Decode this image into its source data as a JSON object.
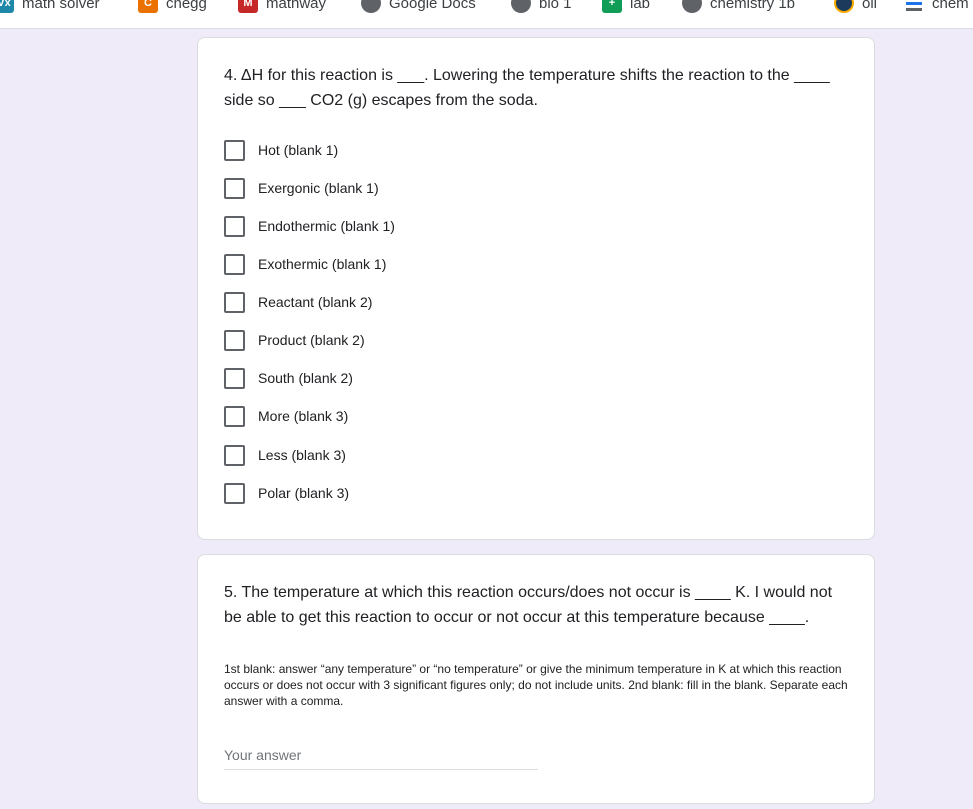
{
  "bookmarks": [
    {
      "label": "math solver",
      "icon": "vx-icon",
      "glyph": "Vx",
      "color": "#1e88a8"
    },
    {
      "label": "chegg",
      "icon": "chegg-icon",
      "glyph": "C",
      "color": "#eb7100"
    },
    {
      "label": "mathway",
      "icon": "mathway-icon",
      "glyph": "M",
      "color": "#c62828"
    },
    {
      "label": "Google Docs",
      "icon": "globe-icon",
      "glyph": "",
      "color": "#5f6368"
    },
    {
      "label": "bio 1",
      "icon": "globe-icon",
      "glyph": "",
      "color": "#5f6368"
    },
    {
      "label": "lab",
      "icon": "google-sheets-icon",
      "glyph": "+",
      "color": "#0f9d58"
    },
    {
      "label": "chemistry 1b",
      "icon": "globe-icon",
      "glyph": "",
      "color": "#5f6368"
    },
    {
      "label": "oli",
      "icon": "oli-icon",
      "glyph": "",
      "color": "#1b3a5c"
    },
    {
      "label": "chem",
      "icon": "stack-icon",
      "glyph": "",
      "color": "#f9ab00"
    }
  ],
  "question4": {
    "title": "4. ΔH for this reaction is ___. Lowering the temperature shifts the reaction to the ____ side so ___ CO2 (g) escapes from the soda.",
    "options": [
      "Hot (blank 1)",
      "Exergonic (blank 1)",
      "Endothermic (blank 1)",
      "Exothermic (blank 1)",
      "Reactant (blank 2)",
      "Product (blank 2)",
      "South (blank 2)",
      "More (blank 3)",
      "Less (blank 3)",
      "Polar (blank 3)"
    ]
  },
  "question5": {
    "title": "5. The temperature at which this reaction occurs/does not occur is ____ K. I would not be able to get this reaction to occur or not occur at this temperature because ____.",
    "description": "1st blank: answer “any temperature” or “no temperature” or give the minimum temperature in K at which this reaction occurs or does not occur with 3 significant figures only; do not include units. 2nd blank: fill in the blank. Separate each answer with a comma.",
    "answer_placeholder": "Your answer",
    "answer_value": ""
  }
}
